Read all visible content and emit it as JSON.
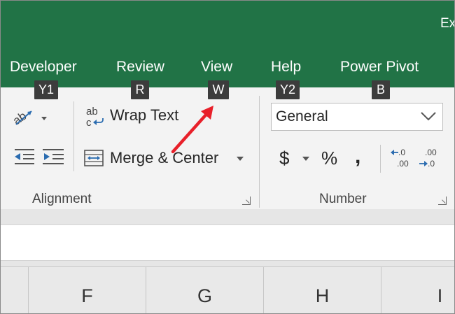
{
  "window": {
    "title_fragment": "Ex"
  },
  "tabs": [
    {
      "label": "Developer",
      "keytip": "Y1"
    },
    {
      "label": "Review",
      "keytip": "R"
    },
    {
      "label": "View",
      "keytip": "W"
    },
    {
      "label": "Help",
      "keytip": "Y2"
    },
    {
      "label": "Power Pivot",
      "keytip": "B"
    }
  ],
  "ribbon": {
    "alignment": {
      "wrap_text_label": "Wrap Text",
      "merge_center_label": "Merge & Center",
      "group_label": "Alignment"
    },
    "number": {
      "format_value": "General",
      "currency_symbol": "$",
      "percent_symbol": "%",
      "comma_symbol": ",",
      "group_label": "Number"
    }
  },
  "columns": [
    "F",
    "G",
    "H",
    "I"
  ],
  "colors": {
    "ribbon_green": "#217346",
    "keytip_bg": "#3c3c3c",
    "annotation_arrow": "#e8202a"
  }
}
